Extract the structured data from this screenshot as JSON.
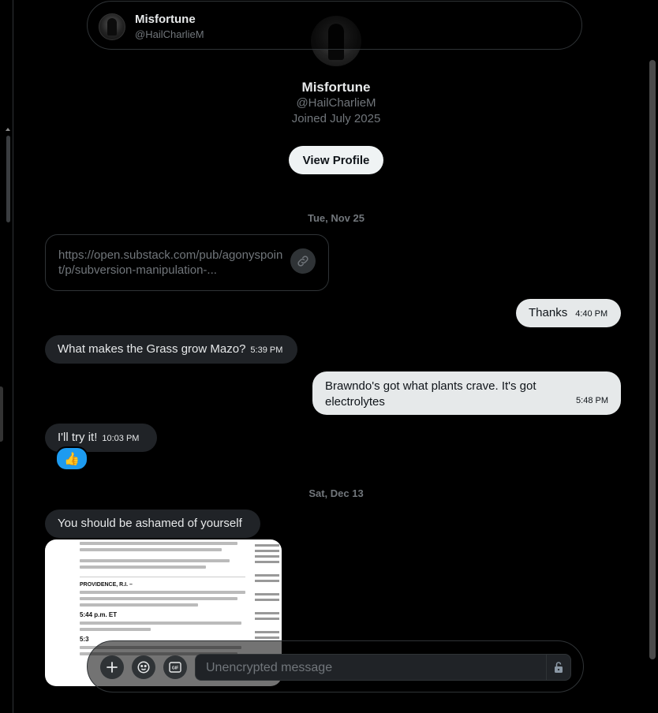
{
  "header": {
    "name": "Misfortune",
    "handle": "@HailCharlieM"
  },
  "profile": {
    "name": "Misfortune",
    "handle": "@HailCharlieM",
    "joined": "Joined July 2025",
    "view_profile_label": "View Profile"
  },
  "conversation": {
    "date1": "Tue, Nov 25",
    "link_card": {
      "url": "https://open.substack.com/pub/agonyspoint/p/subversion-manipulation-..."
    },
    "msg_thanks": {
      "text": "Thanks",
      "time": "4:40 PM"
    },
    "msg_grass": {
      "text": "What makes the Grass grow Mazo?",
      "time": "5:39 PM"
    },
    "msg_brawndo": {
      "text": "Brawndo's got what plants crave. It's got electrolytes",
      "time": "5:48 PM"
    },
    "msg_try": {
      "text": "I'll try it!",
      "time": "10:03 PM"
    },
    "reaction": {
      "emoji": "👍",
      "color": "#1d9bf0"
    },
    "date2": "Sat, Dec 13",
    "msg_ashamed": {
      "text": "You should be ashamed of yourself"
    },
    "attachment": {
      "heading1": "PROVIDENCE, R.I. –",
      "heading2": "5:44 p.m. ET",
      "heading3": "5:3"
    }
  },
  "composer": {
    "placeholder": "Unencrypted message"
  },
  "colors": {
    "background": "#000000",
    "incoming_bubble": "#202327",
    "outgoing_bubble": "#e6e9ea",
    "accent": "#1d9bf0"
  }
}
